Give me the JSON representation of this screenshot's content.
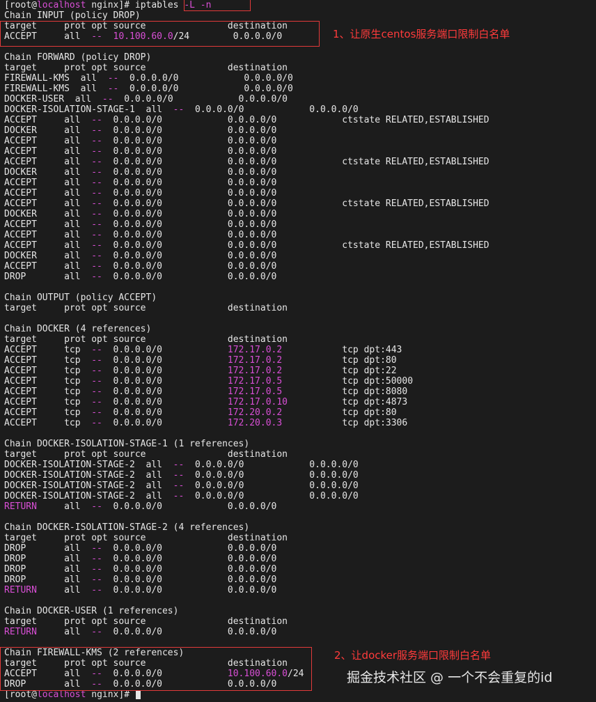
{
  "colors": {
    "background": "#1c1c1c",
    "text": "#e6e6e6",
    "magenta": "#d94fd6",
    "annotation": "#ff3b3b"
  },
  "terminal": {
    "lines": [
      [
        {
          "t": "[root@",
          "c": "default"
        },
        {
          "t": "localhost",
          "c": "magenta"
        },
        {
          "t": " nginx]# ",
          "c": "default"
        },
        {
          "t": "iptables ",
          "c": "default"
        },
        {
          "t": "-L -n",
          "c": "magenta"
        }
      ],
      [
        {
          "t": "Chain INPUT (policy DROP)",
          "c": "default"
        }
      ],
      [
        {
          "t": "target     prot opt source               destination",
          "c": "default"
        }
      ],
      [
        {
          "t": "ACCEPT     all  ",
          "c": "default"
        },
        {
          "t": "--",
          "c": "magenta"
        },
        {
          "t": "  ",
          "c": "default"
        },
        {
          "t": "10.100.60.0",
          "c": "magenta"
        },
        {
          "t": "/24        0.0.0.0/0",
          "c": "default"
        }
      ],
      [
        {
          "t": "",
          "c": "default"
        }
      ],
      [
        {
          "t": "Chain FORWARD (policy DROP)",
          "c": "default"
        }
      ],
      [
        {
          "t": "target     prot opt source               destination",
          "c": "default"
        }
      ],
      [
        {
          "t": "FIREWALL-KMS  all  ",
          "c": "default"
        },
        {
          "t": "--",
          "c": "magenta"
        },
        {
          "t": "  0.0.0.0/0            0.0.0.0/0",
          "c": "default"
        }
      ],
      [
        {
          "t": "FIREWALL-KMS  all  ",
          "c": "default"
        },
        {
          "t": "--",
          "c": "magenta"
        },
        {
          "t": "  0.0.0.0/0            0.0.0.0/0",
          "c": "default"
        }
      ],
      [
        {
          "t": "DOCKER-USER  all  ",
          "c": "default"
        },
        {
          "t": "--",
          "c": "magenta"
        },
        {
          "t": "  0.0.0.0/0            0.0.0.0/0",
          "c": "default"
        }
      ],
      [
        {
          "t": "DOCKER-ISOLATION-STAGE-1  all  ",
          "c": "default"
        },
        {
          "t": "--",
          "c": "magenta"
        },
        {
          "t": "  0.0.0.0/0            0.0.0.0/0",
          "c": "default"
        }
      ],
      [
        {
          "t": "ACCEPT     all  ",
          "c": "default"
        },
        {
          "t": "--",
          "c": "magenta"
        },
        {
          "t": "  0.0.0.0/0            0.0.0.0/0            ctstate RELATED,ESTABLISHED",
          "c": "default"
        }
      ],
      [
        {
          "t": "DOCKER     all  ",
          "c": "default"
        },
        {
          "t": "--",
          "c": "magenta"
        },
        {
          "t": "  0.0.0.0/0            0.0.0.0/0",
          "c": "default"
        }
      ],
      [
        {
          "t": "ACCEPT     all  ",
          "c": "default"
        },
        {
          "t": "--",
          "c": "magenta"
        },
        {
          "t": "  0.0.0.0/0            0.0.0.0/0",
          "c": "default"
        }
      ],
      [
        {
          "t": "ACCEPT     all  ",
          "c": "default"
        },
        {
          "t": "--",
          "c": "magenta"
        },
        {
          "t": "  0.0.0.0/0            0.0.0.0/0",
          "c": "default"
        }
      ],
      [
        {
          "t": "ACCEPT     all  ",
          "c": "default"
        },
        {
          "t": "--",
          "c": "magenta"
        },
        {
          "t": "  0.0.0.0/0            0.0.0.0/0            ctstate RELATED,ESTABLISHED",
          "c": "default"
        }
      ],
      [
        {
          "t": "DOCKER     all  ",
          "c": "default"
        },
        {
          "t": "--",
          "c": "magenta"
        },
        {
          "t": "  0.0.0.0/0            0.0.0.0/0",
          "c": "default"
        }
      ],
      [
        {
          "t": "ACCEPT     all  ",
          "c": "default"
        },
        {
          "t": "--",
          "c": "magenta"
        },
        {
          "t": "  0.0.0.0/0            0.0.0.0/0",
          "c": "default"
        }
      ],
      [
        {
          "t": "ACCEPT     all  ",
          "c": "default"
        },
        {
          "t": "--",
          "c": "magenta"
        },
        {
          "t": "  0.0.0.0/0            0.0.0.0/0",
          "c": "default"
        }
      ],
      [
        {
          "t": "ACCEPT     all  ",
          "c": "default"
        },
        {
          "t": "--",
          "c": "magenta"
        },
        {
          "t": "  0.0.0.0/0            0.0.0.0/0            ctstate RELATED,ESTABLISHED",
          "c": "default"
        }
      ],
      [
        {
          "t": "DOCKER     all  ",
          "c": "default"
        },
        {
          "t": "--",
          "c": "magenta"
        },
        {
          "t": "  0.0.0.0/0            0.0.0.0/0",
          "c": "default"
        }
      ],
      [
        {
          "t": "ACCEPT     all  ",
          "c": "default"
        },
        {
          "t": "--",
          "c": "magenta"
        },
        {
          "t": "  0.0.0.0/0            0.0.0.0/0",
          "c": "default"
        }
      ],
      [
        {
          "t": "ACCEPT     all  ",
          "c": "default"
        },
        {
          "t": "--",
          "c": "magenta"
        },
        {
          "t": "  0.0.0.0/0            0.0.0.0/0",
          "c": "default"
        }
      ],
      [
        {
          "t": "ACCEPT     all  ",
          "c": "default"
        },
        {
          "t": "--",
          "c": "magenta"
        },
        {
          "t": "  0.0.0.0/0            0.0.0.0/0            ctstate RELATED,ESTABLISHED",
          "c": "default"
        }
      ],
      [
        {
          "t": "DOCKER     all  ",
          "c": "default"
        },
        {
          "t": "--",
          "c": "magenta"
        },
        {
          "t": "  0.0.0.0/0            0.0.0.0/0",
          "c": "default"
        }
      ],
      [
        {
          "t": "ACCEPT     all  ",
          "c": "default"
        },
        {
          "t": "--",
          "c": "magenta"
        },
        {
          "t": "  0.0.0.0/0            0.0.0.0/0",
          "c": "default"
        }
      ],
      [
        {
          "t": "DROP       all  ",
          "c": "default"
        },
        {
          "t": "--",
          "c": "magenta"
        },
        {
          "t": "  0.0.0.0/0            0.0.0.0/0",
          "c": "default"
        }
      ],
      [
        {
          "t": "",
          "c": "default"
        }
      ],
      [
        {
          "t": "Chain OUTPUT (policy ACCEPT)",
          "c": "default"
        }
      ],
      [
        {
          "t": "target     prot opt source               destination",
          "c": "default"
        }
      ],
      [
        {
          "t": "",
          "c": "default"
        }
      ],
      [
        {
          "t": "Chain DOCKER (4 references)",
          "c": "default"
        }
      ],
      [
        {
          "t": "target     prot opt source               destination",
          "c": "default"
        }
      ],
      [
        {
          "t": "ACCEPT     tcp  ",
          "c": "default"
        },
        {
          "t": "--",
          "c": "magenta"
        },
        {
          "t": "  0.0.0.0/0            ",
          "c": "default"
        },
        {
          "t": "172.17.0.2",
          "c": "magenta"
        },
        {
          "t": "           tcp dpt:443",
          "c": "default"
        }
      ],
      [
        {
          "t": "ACCEPT     tcp  ",
          "c": "default"
        },
        {
          "t": "--",
          "c": "magenta"
        },
        {
          "t": "  0.0.0.0/0            ",
          "c": "default"
        },
        {
          "t": "172.17.0.2",
          "c": "magenta"
        },
        {
          "t": "           tcp dpt:80",
          "c": "default"
        }
      ],
      [
        {
          "t": "ACCEPT     tcp  ",
          "c": "default"
        },
        {
          "t": "--",
          "c": "magenta"
        },
        {
          "t": "  0.0.0.0/0            ",
          "c": "default"
        },
        {
          "t": "172.17.0.2",
          "c": "magenta"
        },
        {
          "t": "           tcp dpt:22",
          "c": "default"
        }
      ],
      [
        {
          "t": "ACCEPT     tcp  ",
          "c": "default"
        },
        {
          "t": "--",
          "c": "magenta"
        },
        {
          "t": "  0.0.0.0/0            ",
          "c": "default"
        },
        {
          "t": "172.17.0.5",
          "c": "magenta"
        },
        {
          "t": "           tcp dpt:50000",
          "c": "default"
        }
      ],
      [
        {
          "t": "ACCEPT     tcp  ",
          "c": "default"
        },
        {
          "t": "--",
          "c": "magenta"
        },
        {
          "t": "  0.0.0.0/0            ",
          "c": "default"
        },
        {
          "t": "172.17.0.5",
          "c": "magenta"
        },
        {
          "t": "           tcp dpt:8080",
          "c": "default"
        }
      ],
      [
        {
          "t": "ACCEPT     tcp  ",
          "c": "default"
        },
        {
          "t": "--",
          "c": "magenta"
        },
        {
          "t": "  0.0.0.0/0            ",
          "c": "default"
        },
        {
          "t": "172.17.0.10",
          "c": "magenta"
        },
        {
          "t": "          tcp dpt:4873",
          "c": "default"
        }
      ],
      [
        {
          "t": "ACCEPT     tcp  ",
          "c": "default"
        },
        {
          "t": "--",
          "c": "magenta"
        },
        {
          "t": "  0.0.0.0/0            ",
          "c": "default"
        },
        {
          "t": "172.20.0.2",
          "c": "magenta"
        },
        {
          "t": "           tcp dpt:80",
          "c": "default"
        }
      ],
      [
        {
          "t": "ACCEPT     tcp  ",
          "c": "default"
        },
        {
          "t": "--",
          "c": "magenta"
        },
        {
          "t": "  0.0.0.0/0            ",
          "c": "default"
        },
        {
          "t": "172.20.0.3",
          "c": "magenta"
        },
        {
          "t": "           tcp dpt:3306",
          "c": "default"
        }
      ],
      [
        {
          "t": "",
          "c": "default"
        }
      ],
      [
        {
          "t": "Chain DOCKER-ISOLATION-STAGE-1 (1 references)",
          "c": "default"
        }
      ],
      [
        {
          "t": "target     prot opt source               destination",
          "c": "default"
        }
      ],
      [
        {
          "t": "DOCKER-ISOLATION-STAGE-2  all  ",
          "c": "default"
        },
        {
          "t": "--",
          "c": "magenta"
        },
        {
          "t": "  0.0.0.0/0            0.0.0.0/0",
          "c": "default"
        }
      ],
      [
        {
          "t": "DOCKER-ISOLATION-STAGE-2  all  ",
          "c": "default"
        },
        {
          "t": "--",
          "c": "magenta"
        },
        {
          "t": "  0.0.0.0/0            0.0.0.0/0",
          "c": "default"
        }
      ],
      [
        {
          "t": "DOCKER-ISOLATION-STAGE-2  all  ",
          "c": "default"
        },
        {
          "t": "--",
          "c": "magenta"
        },
        {
          "t": "  0.0.0.0/0            0.0.0.0/0",
          "c": "default"
        }
      ],
      [
        {
          "t": "DOCKER-ISOLATION-STAGE-2  all  ",
          "c": "default"
        },
        {
          "t": "--",
          "c": "magenta"
        },
        {
          "t": "  0.0.0.0/0            0.0.0.0/0",
          "c": "default"
        }
      ],
      [
        {
          "t": "RETURN",
          "c": "magenta"
        },
        {
          "t": "     all  ",
          "c": "default"
        },
        {
          "t": "--",
          "c": "magenta"
        },
        {
          "t": "  0.0.0.0/0            0.0.0.0/0",
          "c": "default"
        }
      ],
      [
        {
          "t": "",
          "c": "default"
        }
      ],
      [
        {
          "t": "Chain DOCKER-ISOLATION-STAGE-2 (4 references)",
          "c": "default"
        }
      ],
      [
        {
          "t": "target     prot opt source               destination",
          "c": "default"
        }
      ],
      [
        {
          "t": "DROP       all  ",
          "c": "default"
        },
        {
          "t": "--",
          "c": "magenta"
        },
        {
          "t": "  0.0.0.0/0            0.0.0.0/0",
          "c": "default"
        }
      ],
      [
        {
          "t": "DROP       all  ",
          "c": "default"
        },
        {
          "t": "--",
          "c": "magenta"
        },
        {
          "t": "  0.0.0.0/0            0.0.0.0/0",
          "c": "default"
        }
      ],
      [
        {
          "t": "DROP       all  ",
          "c": "default"
        },
        {
          "t": "--",
          "c": "magenta"
        },
        {
          "t": "  0.0.0.0/0            0.0.0.0/0",
          "c": "default"
        }
      ],
      [
        {
          "t": "DROP       all  ",
          "c": "default"
        },
        {
          "t": "--",
          "c": "magenta"
        },
        {
          "t": "  0.0.0.0/0            0.0.0.0/0",
          "c": "default"
        }
      ],
      [
        {
          "t": "RETURN",
          "c": "magenta"
        },
        {
          "t": "     all  ",
          "c": "default"
        },
        {
          "t": "--",
          "c": "magenta"
        },
        {
          "t": "  0.0.0.0/0            0.0.0.0/0",
          "c": "default"
        }
      ],
      [
        {
          "t": "",
          "c": "default"
        }
      ],
      [
        {
          "t": "Chain DOCKER-USER (1 references)",
          "c": "default"
        }
      ],
      [
        {
          "t": "target     prot opt source               destination",
          "c": "default"
        }
      ],
      [
        {
          "t": "RETURN",
          "c": "magenta"
        },
        {
          "t": "     all  ",
          "c": "default"
        },
        {
          "t": "--",
          "c": "magenta"
        },
        {
          "t": "  0.0.0.0/0            0.0.0.0/0",
          "c": "default"
        }
      ],
      [
        {
          "t": "",
          "c": "default"
        }
      ],
      [
        {
          "t": "Chain FIREWALL-KMS (2 references)",
          "c": "default"
        }
      ],
      [
        {
          "t": "target     prot opt source               destination",
          "c": "default"
        }
      ],
      [
        {
          "t": "ACCEPT     all  ",
          "c": "default"
        },
        {
          "t": "--",
          "c": "magenta"
        },
        {
          "t": "  0.0.0.0/0            ",
          "c": "default"
        },
        {
          "t": "10.100.60.0",
          "c": "magenta"
        },
        {
          "t": "/24",
          "c": "default"
        }
      ],
      [
        {
          "t": "DROP       all  ",
          "c": "default"
        },
        {
          "t": "--",
          "c": "magenta"
        },
        {
          "t": "  0.0.0.0/0            0.0.0.0/0",
          "c": "default"
        }
      ],
      [
        {
          "t": "[root@",
          "c": "default"
        },
        {
          "t": "localhost",
          "c": "magenta"
        },
        {
          "t": " nginx]# ",
          "c": "default"
        }
      ]
    ]
  },
  "annotations": {
    "note1": "1、让原生centos服务端口限制白名单",
    "note2": "2、让docker服务端口限制白名单"
  },
  "watermark": "掘金技术社区 @ 一个不会重复的id"
}
